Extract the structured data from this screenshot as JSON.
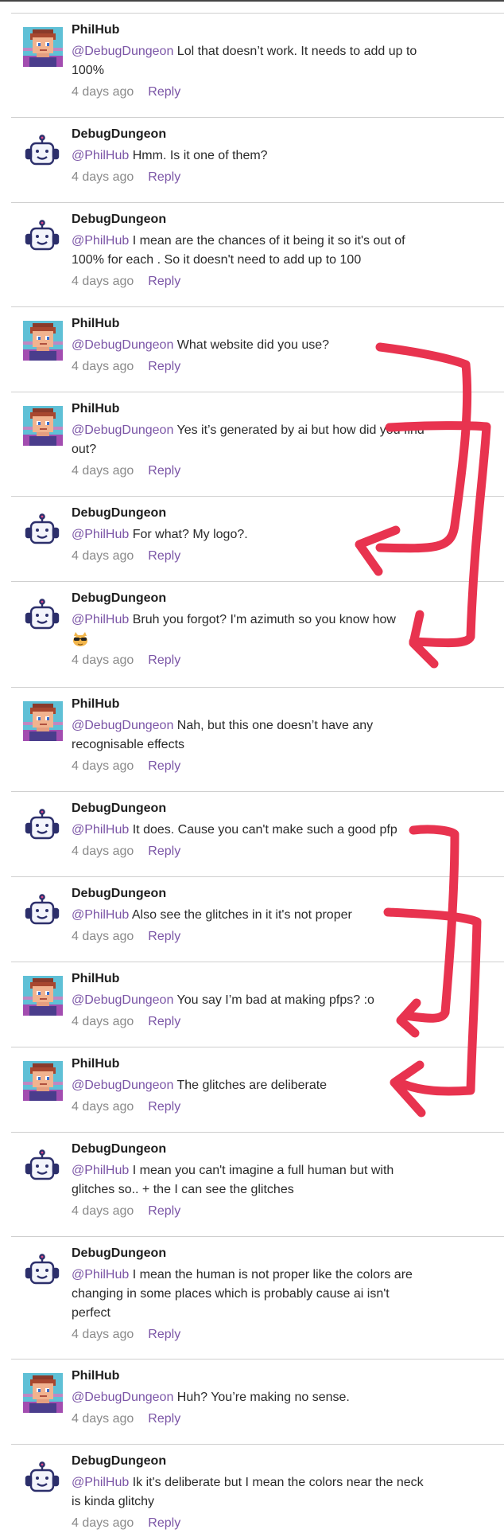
{
  "colors": {
    "mention": "#7b55a6",
    "reply": "#7b55a6",
    "meta": "#8a8a8a",
    "annotation_stroke": "#e8334f"
  },
  "comments": [
    {
      "author": "PhilHub",
      "avatar": "pixel-person-avatar",
      "mention": "@DebugDungeon",
      "text": " Lol that doesn’t work. It needs to add up to 100%",
      "time": "4 days ago",
      "reply": "Reply"
    },
    {
      "author": "DebugDungeon",
      "avatar": "robot-avatar",
      "mention": "@PhilHub",
      "text": " Hmm. Is it one of them?",
      "time": "4 days ago",
      "reply": "Reply"
    },
    {
      "author": "DebugDungeon",
      "avatar": "robot-avatar",
      "mention": "@PhilHub",
      "text": " I mean are the chances of it being it so it's out of 100% for each . So it doesn't need to add up to 100",
      "time": "4 days ago",
      "reply": "Reply"
    },
    {
      "author": "PhilHub",
      "avatar": "pixel-person-avatar",
      "mention": "@DebugDungeon",
      "text": " What website did you use?",
      "time": "4 days ago",
      "reply": "Reply"
    },
    {
      "author": "PhilHub",
      "avatar": "pixel-person-avatar",
      "mention": "@DebugDungeon",
      "text": " Yes it’s generated by ai but how did you find out?",
      "time": "4 days ago",
      "reply": "Reply"
    },
    {
      "author": "DebugDungeon",
      "avatar": "robot-avatar",
      "mention": "@PhilHub",
      "text": " For what? My logo?.",
      "time": "4 days ago",
      "reply": "Reply"
    },
    {
      "author": "DebugDungeon",
      "avatar": "robot-avatar",
      "mention": "@PhilHub",
      "text": " Bruh you forgot? I'm azimuth so you know how",
      "time": "4 days ago",
      "reply": "Reply",
      "emoji": "cat-sunglasses-emoji"
    },
    {
      "author": "PhilHub",
      "avatar": "pixel-person-avatar",
      "mention": "@DebugDungeon",
      "text": " Nah, but this one doesn’t have any recognisable effects",
      "time": "4 days ago",
      "reply": "Reply"
    },
    {
      "author": "DebugDungeon",
      "avatar": "robot-avatar",
      "mention": "@PhilHub",
      "text": " It does. Cause you can't make such a good pfp",
      "time": "4 days ago",
      "reply": "Reply"
    },
    {
      "author": "DebugDungeon",
      "avatar": "robot-avatar",
      "mention": "@PhilHub",
      "text": " Also see the glitches in it it's not proper",
      "time": "4 days ago",
      "reply": "Reply"
    },
    {
      "author": "PhilHub",
      "avatar": "pixel-person-avatar",
      "mention": "@DebugDungeon",
      "text": " You say I’m bad at making pfps? :o",
      "time": "4 days ago",
      "reply": "Reply"
    },
    {
      "author": "PhilHub",
      "avatar": "pixel-person-avatar",
      "mention": "@DebugDungeon",
      "text": " The glitches are deliberate",
      "time": "4 days ago",
      "reply": "Reply"
    },
    {
      "author": "DebugDungeon",
      "avatar": "robot-avatar",
      "mention": "@PhilHub",
      "text": " I mean you can't imagine a full human but with glitches so.. + the I can see the glitches",
      "time": "4 days ago",
      "reply": "Reply"
    },
    {
      "author": "DebugDungeon",
      "avatar": "robot-avatar",
      "mention": "@PhilHub",
      "text": " I mean the human is not proper like the colors are changing in some places which is probably cause ai isn't perfect",
      "time": "4 days ago",
      "reply": "Reply"
    },
    {
      "author": "PhilHub",
      "avatar": "pixel-person-avatar",
      "mention": "@DebugDungeon",
      "text": " Huh? You’re making no sense.",
      "time": "4 days ago",
      "reply": "Reply"
    },
    {
      "author": "DebugDungeon",
      "avatar": "robot-avatar",
      "mention": "@PhilHub",
      "text": " Ik it's deliberate but I mean the colors near the neck is kinda glitchy",
      "time": "4 days ago",
      "reply": "Reply"
    }
  ]
}
